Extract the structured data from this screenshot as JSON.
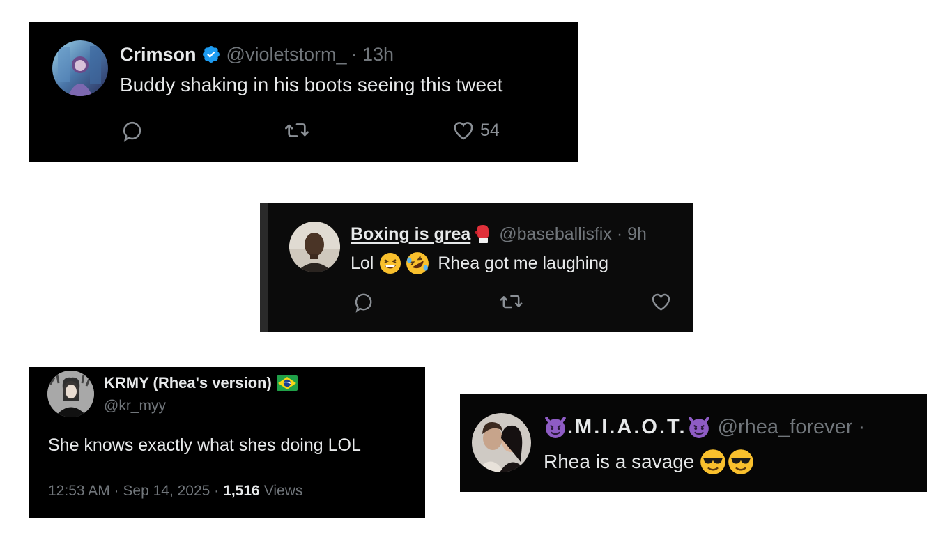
{
  "tweets": [
    {
      "name": "Crimson",
      "handle": "@violetstorm_",
      "time": "· 13h",
      "text": "Buddy shaking in his boots seeing this tweet",
      "likes": "54",
      "verified": true
    },
    {
      "name": "Boxing is grea",
      "handle": "@baseballisfix",
      "time": "· 9h",
      "text_start": "Lol",
      "text_end": "Rhea got me laughing"
    },
    {
      "name": "KRMY (Rhea's version)",
      "handle": "@kr_myy",
      "text": "She knows exactly what shes doing LOL",
      "date": "12:53 AM · Sep 14, 2025 ·",
      "views_count": "1,516",
      "views_label": "Views"
    },
    {
      "name": ".M.I.A.O.T.",
      "handle": "@rhea_forever ·",
      "text": "Rhea is a savage"
    }
  ],
  "colors": {
    "verified": "#1d9bf0",
    "text": "#e7e9ea",
    "muted": "#71767b",
    "background": "#000000"
  },
  "icons": [
    "verified-badge-icon",
    "reply-icon",
    "retweet-icon",
    "like-icon",
    "boxing-glove-emoji",
    "grinning-squinting-emoji",
    "rolling-laughing-emoji",
    "brazil-flag-emoji",
    "smiling-imp-emoji",
    "sunglasses-emoji"
  ]
}
